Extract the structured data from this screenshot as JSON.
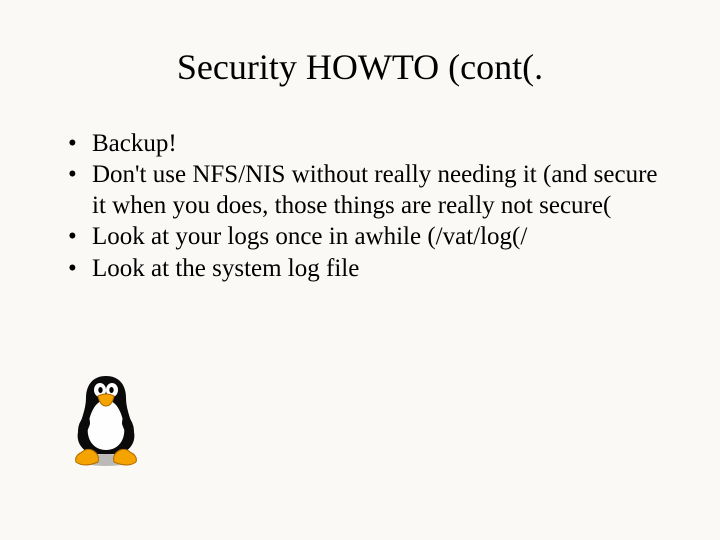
{
  "title": "Security HOWTO (cont(.",
  "bullets": [
    "Backup!",
    "Don't use NFS/NIS without really needing it (and secure it when you does, those things are really not secure(",
    "Look at your logs once in awhile (/vat/log(/",
    "Look at the system log file"
  ],
  "icon": "tux-penguin-icon"
}
